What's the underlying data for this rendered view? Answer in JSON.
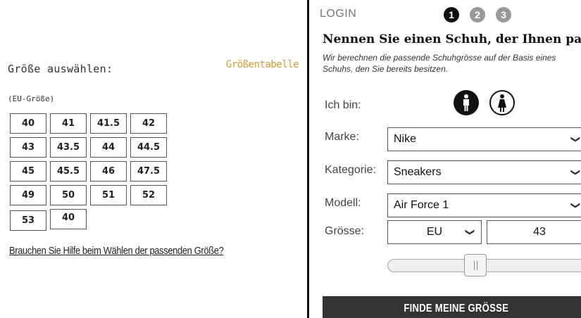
{
  "left_panel": {
    "title": "Größe auswählen:",
    "subtitle": "(EU-Größe)",
    "size_table_link": "Größentabelle",
    "sizes": [
      "40",
      "41",
      "41.5",
      "42",
      "43",
      "43.5",
      "44",
      "44.5",
      "45",
      "45.5",
      "46",
      "47.5",
      "49",
      "50",
      "51",
      "52",
      "53",
      "40"
    ],
    "help_link": "Brauchen Sie Hilfe beim Wählen der passenden Größe?"
  },
  "right_panel": {
    "login_label": "LOGIN",
    "steps": [
      "1",
      "2",
      "3"
    ],
    "heading": "Nennen Sie einen Schuh, der Ihnen passt",
    "description_line1": "Wir berechnen die passende Schuhgrösse auf der Basis eines",
    "description_line2": "Schuhs, den Sie bereits besitzen.",
    "gender_label": "Ich bin:",
    "brand_label": "Marke:",
    "brand_value": "Nike",
    "category_label": "Kategorie:",
    "category_value": "Sneakers",
    "model_label": "Modell:",
    "model_value": "Air Force 1",
    "size_label": "Grösse:",
    "unit_value": "EU",
    "size_value": "43",
    "slider_fraction": 0.43,
    "cta_label": "FINDE MEINE GRÖSSE"
  },
  "icons": {
    "chevron": "chevron-down-icon",
    "male": "male-icon",
    "female": "female-icon"
  },
  "colors": {
    "accent_gold": "#d49a2c",
    "button_dark": "#333333",
    "step_active": "#111111",
    "step_inactive": "#999999"
  }
}
